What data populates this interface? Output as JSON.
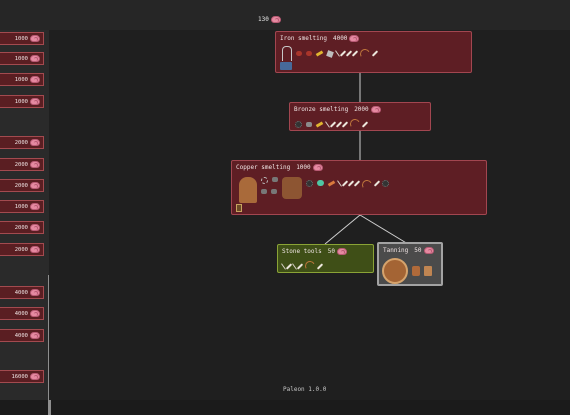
{
  "resources": {
    "amount": "130",
    "icon": "brain-icon"
  },
  "sidebar_items": [
    {
      "cost": "1000"
    },
    {
      "cost": "1000"
    },
    {
      "cost": "1000"
    },
    {
      "cost": "1000"
    },
    {
      "cost": "2000"
    },
    {
      "cost": "2000"
    },
    {
      "cost": "2000"
    },
    {
      "cost": "1000"
    },
    {
      "cost": "2000"
    },
    {
      "cost": "2000"
    },
    {
      "cost": "4000"
    },
    {
      "cost": "4000"
    },
    {
      "cost": "4000"
    },
    {
      "cost": "16000"
    }
  ],
  "nodes": {
    "iron": {
      "title": "Iron smelting",
      "cost": "4000"
    },
    "bronze": {
      "title": "Bronze smelting",
      "cost": "2000"
    },
    "copper": {
      "title": "Copper smelting",
      "cost": "1000"
    },
    "stone": {
      "title": "Stone tools",
      "cost": "50"
    },
    "tanning": {
      "title": "Tanning",
      "cost": "50"
    }
  },
  "footer": {
    "version": "Paleon 1.0.0"
  },
  "colors": {
    "researched": "#5e1e24",
    "available": "#3f4f17",
    "selected": "#4b4b4b",
    "connector": "#cfcfcf"
  }
}
